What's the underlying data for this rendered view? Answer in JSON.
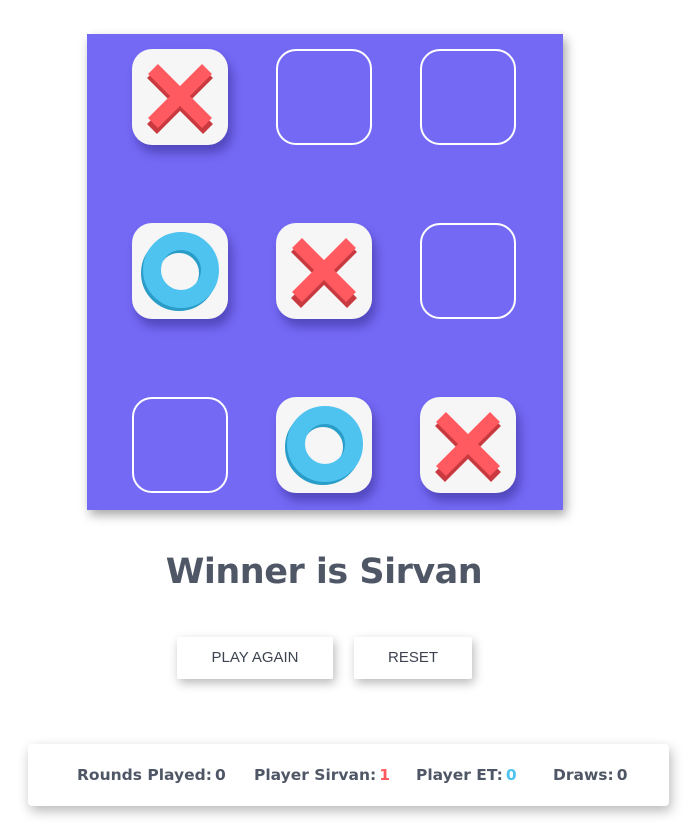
{
  "board": {
    "cells": [
      "X",
      "",
      "",
      "O",
      "X",
      "",
      "",
      "O",
      "X"
    ]
  },
  "status": {
    "winner_text": "Winner is Sirvan"
  },
  "buttons": {
    "play_again": "PLAY AGAIN",
    "reset": "RESET"
  },
  "stats": {
    "rounds_label": "Rounds Played:",
    "rounds_value": "0",
    "player_x_label": "Player Sirvan:",
    "player_x_value": "1",
    "player_o_label": "Player ET:",
    "player_o_value": "0",
    "draws_label": "Draws:",
    "draws_value": "0"
  },
  "colors": {
    "board_bg": "#7469f5",
    "x_mark": "#ff5a5f",
    "o_mark": "#4ec3f0",
    "text": "#4f5766"
  }
}
